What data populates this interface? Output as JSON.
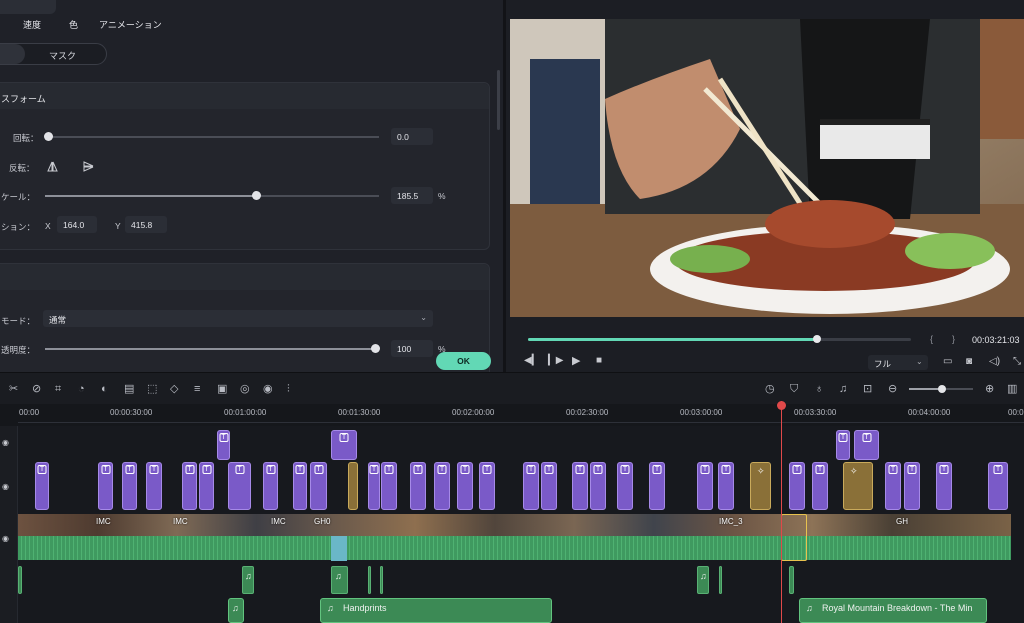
{
  "properties": {
    "tabs": [
      "速度",
      "色",
      "アニメーション"
    ],
    "mask_label": "マスク",
    "transform": {
      "section_title": "スフォーム",
      "rotation_label": "回転：",
      "rotation_value": "0.0",
      "flip_label": "反転：",
      "scale_label": "ケール：",
      "scale_value": "185.5",
      "scale_unit": "%",
      "position_label": "ション：",
      "x_label": "X",
      "x_value": "164.0",
      "y_label": "Y",
      "y_value": "415.8"
    },
    "compositing": {
      "blend_label": "モード：",
      "blend_value": "通常",
      "opacity_label": "透明度：",
      "opacity_value": "100",
      "opacity_unit": "%"
    },
    "ok_label": "OK",
    "scale_level": 0.58,
    "opacity_level": 1.0
  },
  "preview": {
    "timecode": "00:03:21:03",
    "quality": "フル",
    "progress": 0.755
  },
  "ruler": {
    "labels": [
      "00:00",
      "00:00:30:00",
      "00:01:00:00",
      "00:01:30:00",
      "00:02:00:00",
      "00:02:30:00",
      "00:03:00:00",
      "00:03:30:00",
      "00:04:00:00",
      "00:0"
    ]
  },
  "video_labels": [
    "IMC",
    "IMC",
    "IMC",
    "GH0",
    "IMC_3",
    "GH"
  ],
  "music": {
    "track1": "Handprints",
    "track2": "Royal Mountain Breakdown - The Min"
  },
  "colors": {
    "accent": "#62d8b5",
    "title_clip": "#7a5ac8",
    "effect_clip": "#8a7038",
    "audio_clip": "#3c8a55",
    "playhead": "#e0494a"
  }
}
